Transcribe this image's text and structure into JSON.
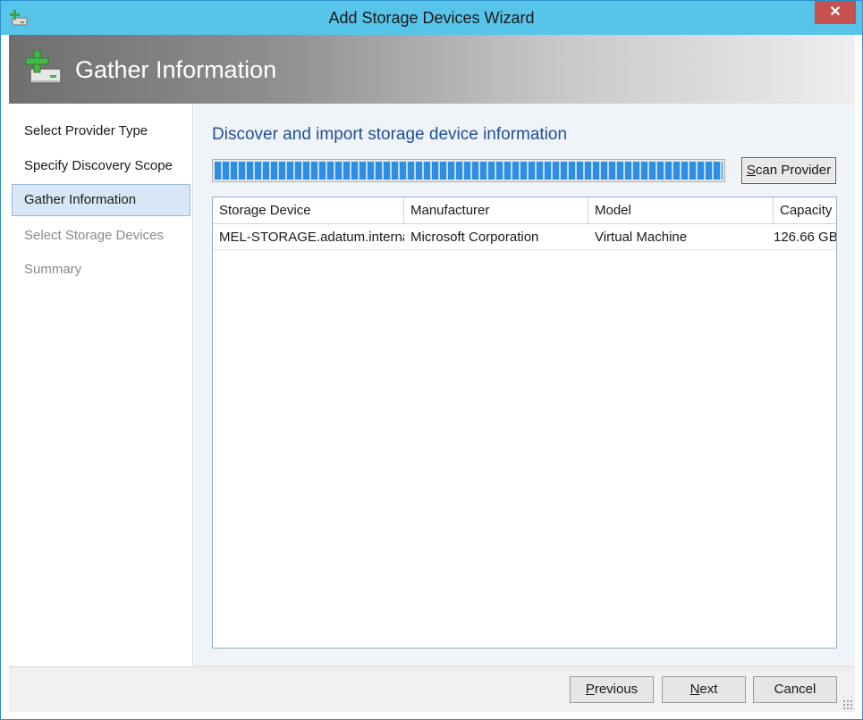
{
  "window": {
    "title": "Add Storage Devices Wizard",
    "close_label": "✕"
  },
  "header": {
    "title": "Gather Information"
  },
  "nav": {
    "items": [
      {
        "label": "Select Provider Type",
        "state": "completed"
      },
      {
        "label": "Specify Discovery Scope",
        "state": "completed"
      },
      {
        "label": "Gather Information",
        "state": "current"
      },
      {
        "label": "Select Storage Devices",
        "state": "disabled"
      },
      {
        "label": "Summary",
        "state": "disabled"
      }
    ]
  },
  "main": {
    "heading": "Discover and import storage device information",
    "progress": 1.0,
    "scan_button": {
      "label": "Scan Provider",
      "mnemonic": "S"
    }
  },
  "table": {
    "columns": [
      "Storage Device",
      "Manufacturer",
      "Model",
      "Capacity"
    ],
    "rows": [
      [
        "MEL-STORAGE.adatum.internal",
        "Microsoft Corporation",
        "Virtual Machine",
        "126.66 GB"
      ]
    ]
  },
  "footer": {
    "previous_label": "Previous",
    "next_label": "Next",
    "cancel_label": "Cancel"
  },
  "colors": {
    "titlebar": "#57c4ea",
    "accent_heading": "#1f4e96",
    "progress": "#2f8de4",
    "close": "#c75050"
  }
}
